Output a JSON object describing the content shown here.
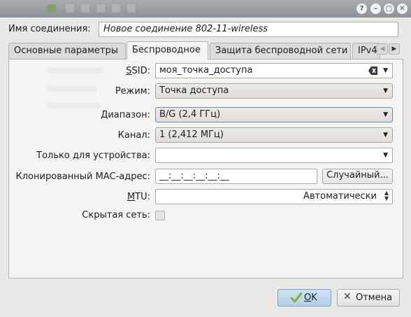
{
  "titlebar": {
    "help": "?",
    "minimize": "–",
    "maximize": "□",
    "close": "✕"
  },
  "connection": {
    "label": "Имя соединения:",
    "value": "Новое соединение 802-11-wireless"
  },
  "tabs": [
    {
      "label": "Основные параметры",
      "active": false
    },
    {
      "label": "Беспроводное",
      "active": true
    },
    {
      "label": "Защита беспроводной сети",
      "active": false
    },
    {
      "label": "IPv4",
      "active": false
    }
  ],
  "form": {
    "ssid": {
      "label_ul": "S",
      "label_rest": "SID:",
      "value": "моя_точка_доступа"
    },
    "mode": {
      "label": "Режим:",
      "value": "Точка доступа"
    },
    "band": {
      "label": "Диапазон:",
      "value": "B/G (2,4 ГГц)"
    },
    "channel": {
      "label": "Канал:",
      "value": "1 (2,412 МГц)"
    },
    "device": {
      "label": "Только для устройства:",
      "value": ""
    },
    "mac": {
      "label": "Клонированный MAC-адрес:",
      "value": "__:__:__:__:__:__",
      "random_button": "Случайный..."
    },
    "mtu": {
      "label_ul": "M",
      "label_rest": "TU:",
      "value": "Автоматически"
    },
    "hidden": {
      "label": "Скрытая сеть:",
      "checked": false
    }
  },
  "buttons": {
    "ok_ul": "O",
    "ok_rest": "K",
    "cancel": "Отмена"
  }
}
